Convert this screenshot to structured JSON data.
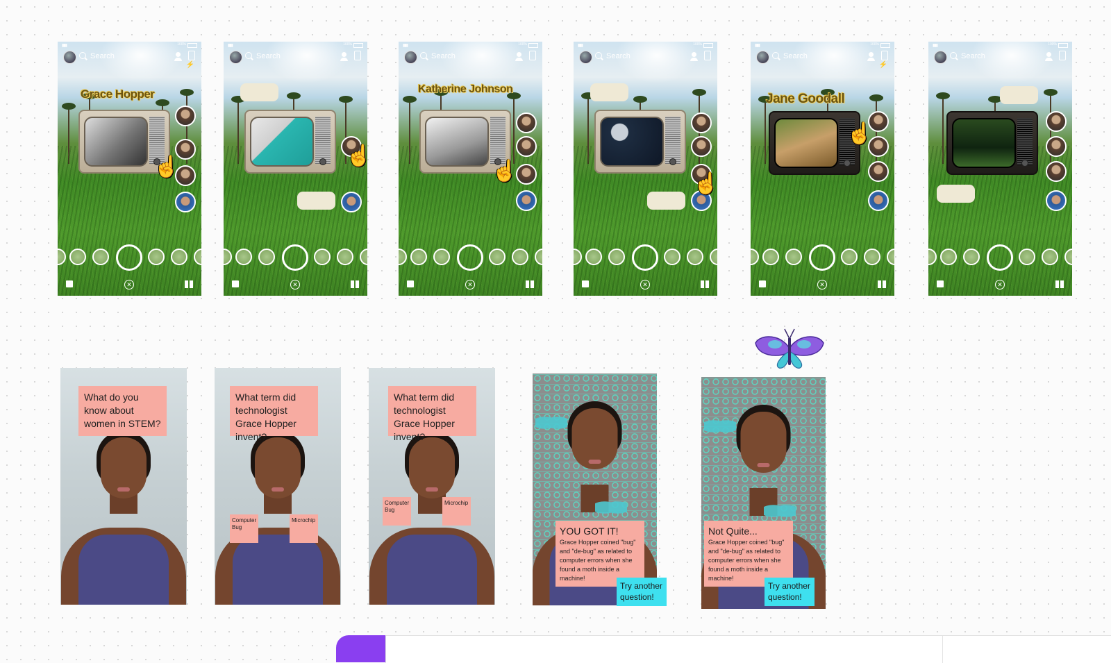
{
  "snapchat_frames": [
    {
      "name": "Grace Hopper",
      "search": "Search",
      "scene": "scene-bw",
      "tv": "light"
    },
    {
      "name": "",
      "search": "Search",
      "scene": "scene-teal",
      "tv": "light"
    },
    {
      "name": "Katherine Johnson",
      "search": "Search",
      "scene": "scene-office",
      "tv": "light"
    },
    {
      "name": "",
      "search": "Search",
      "scene": "scene-moon",
      "tv": "light"
    },
    {
      "name": "Jane Goodall",
      "search": "Search",
      "scene": "scene-nature",
      "tv": "dark"
    },
    {
      "name": "",
      "search": "Search",
      "scene": "scene-forest",
      "tv": "dark"
    }
  ],
  "status_bar": {
    "battery": "100%"
  },
  "quiz_cards": [
    {
      "question": "What do you know about women in STEM?"
    },
    {
      "question": "What term did technologist Grace Hopper invent?",
      "answers": [
        "Computer Bug",
        "Microchip"
      ]
    },
    {
      "question": "What term did technologist Grace Hopper invent?",
      "answers": [
        "Computer Bug",
        "Microchip"
      ]
    }
  ],
  "result_cards": [
    {
      "title": "YOU GOT IT!",
      "body": "Grace Hopper coined \"bug\" and \"de-bug\" as related to computer errors when she found a moth inside a machine!",
      "button": "Try another question!"
    },
    {
      "title": "Not Quite...",
      "body": "Grace Hopper coined \"bug\" and \"de-bug\" as related to computer errors when she found a moth inside a machine!",
      "button": "Try another question!"
    }
  ],
  "colors": {
    "note": "#f7aba1",
    "button": "#3ee0ef",
    "accent_purple": "#8a3ff0",
    "moth": "#4dc8d0"
  },
  "icons": [
    "search-icon",
    "add-friend-icon",
    "flip-camera-icon",
    "flash-icon",
    "hand-cursor-icon",
    "memories-icon",
    "close-icon",
    "stories-icon",
    "moth-icon"
  ]
}
